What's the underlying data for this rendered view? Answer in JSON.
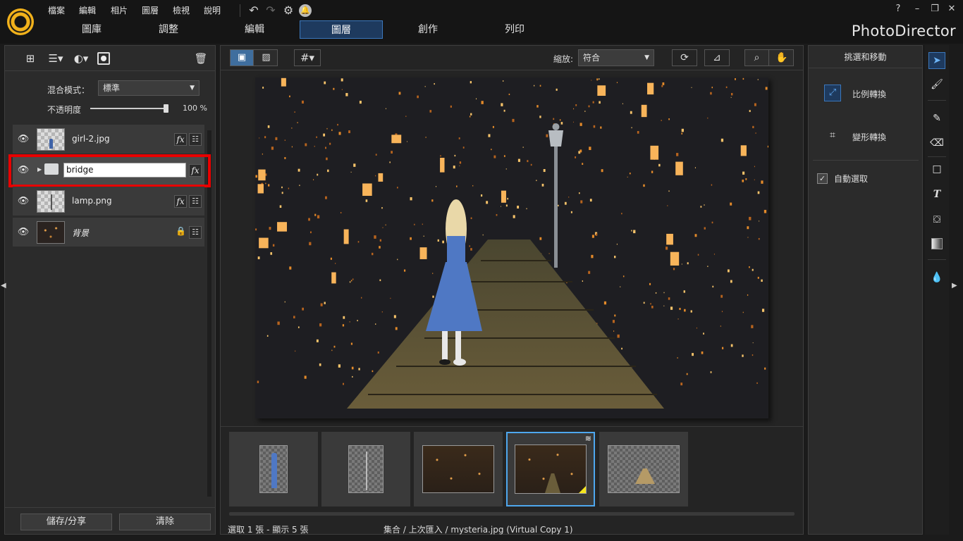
{
  "menu": {
    "file": "檔案",
    "edit": "編輯",
    "photo": "相片",
    "layers": "圖層",
    "view": "檢視",
    "help": "說明"
  },
  "window": {
    "help_icon": "?"
  },
  "tabs": [
    {
      "label": "圖庫"
    },
    {
      "label": "調整"
    },
    {
      "label": "編輯"
    },
    {
      "label": "圖層"
    },
    {
      "label": "創作"
    },
    {
      "label": "列印"
    }
  ],
  "brand": "PhotoDirector",
  "left": {
    "blend_label": "混合模式：",
    "blend_value": "標準",
    "opacity_label": "不透明度",
    "opacity_value": "100 %",
    "opacity_fraction": 1.0,
    "layers": [
      {
        "name": "girl-2.jpg"
      },
      {
        "name": "bridge",
        "editing": true
      },
      {
        "name": "lamp.png"
      },
      {
        "name": "背景",
        "locked": true
      }
    ],
    "save_share": "儲存/分享",
    "clear": "清除"
  },
  "center": {
    "zoom_label": "縮放:",
    "zoom_value": "符合",
    "status_left": "選取 1 張 - 顯示 5 張",
    "status_path": "集合 / 上次匯入 / mysteria.jpg (Virtual Copy 1)"
  },
  "right": {
    "title": "挑選和移動",
    "scale": "比例轉換",
    "transform": "變形轉換",
    "auto_select": "自動選取"
  },
  "colors": {
    "accent": "#3b78bd",
    "highlight": "#e80000",
    "brand_yellow": "#f2b21b"
  }
}
